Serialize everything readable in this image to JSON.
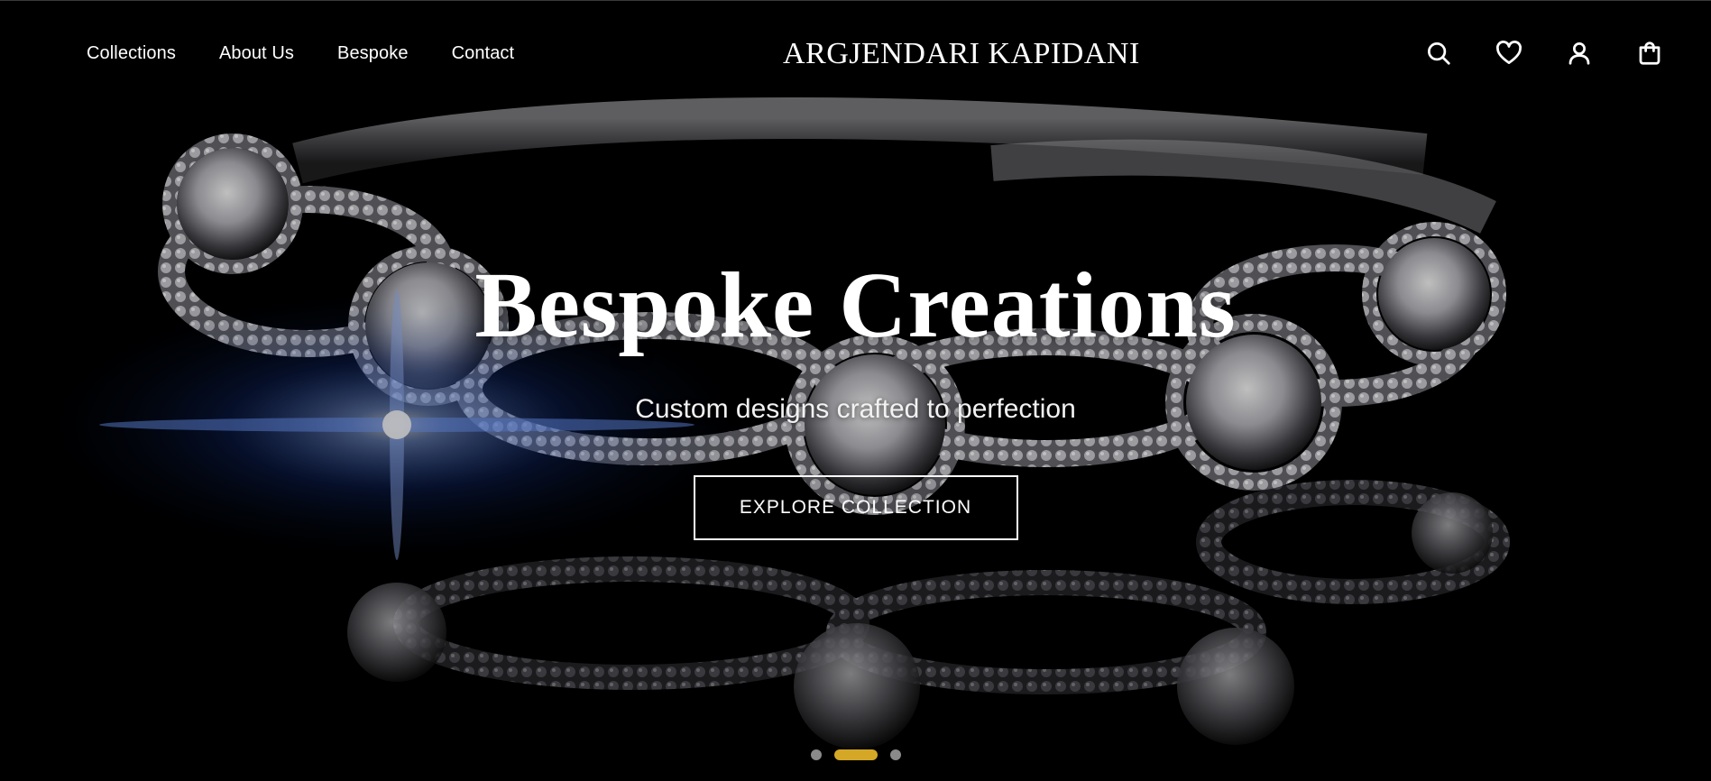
{
  "nav": {
    "left": [
      {
        "label": "Collections"
      },
      {
        "label": "About Us"
      },
      {
        "label": "Bespoke"
      },
      {
        "label": "Contact"
      }
    ],
    "brand": "ARGJENDARI KAPIDANI",
    "icons": [
      "search-icon",
      "heart-icon",
      "user-icon",
      "shopping-bag-icon"
    ]
  },
  "hero": {
    "headline": "Bespoke Creations",
    "subheadline": "Custom designs crafted to perfection",
    "cta_label": "EXPLORE COLLECTION"
  },
  "carousel": {
    "slides": 3,
    "active_index": 1
  },
  "colors": {
    "background": "#000000",
    "text": "#ffffff",
    "accent": "#d4a826",
    "dot_inactive": "#8a8a8a"
  }
}
